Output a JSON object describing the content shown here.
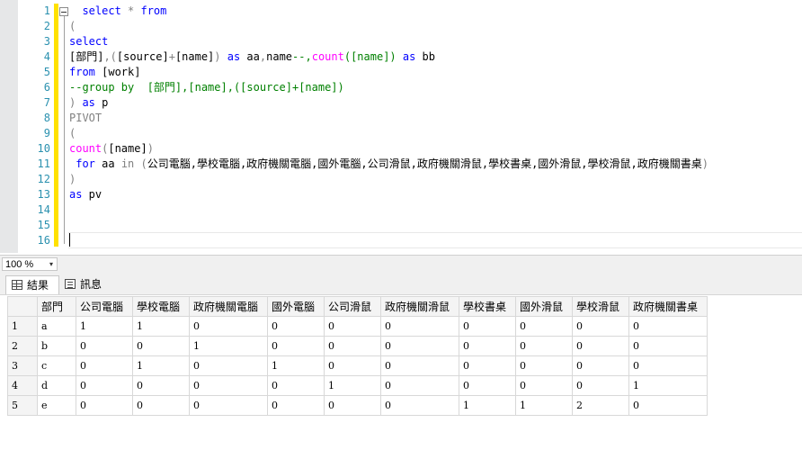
{
  "editor": {
    "line_numbers": [
      "1",
      "2",
      "3",
      "4",
      "5",
      "6",
      "7",
      "8",
      "9",
      "10",
      "11",
      "12",
      "13",
      "14",
      "15",
      "16"
    ],
    "lines": {
      "l1": {
        "a": "  select",
        "b": " * ",
        "c": "from"
      },
      "l2": {
        "a": "("
      },
      "l3": {
        "a": "select"
      },
      "l4": {
        "a": "[部門]",
        "b": ",(",
        "c": "[source]",
        "d": "+",
        "e": "[name]",
        "f": ") ",
        "g": "as",
        "h": " aa",
        "i": ",",
        "j": "name",
        "k": "--,count([name]) as bb"
      },
      "l4b": {
        "a": "count",
        "b": "([name]) ",
        "c": "as",
        "d": " bb"
      },
      "l5": {
        "a": "from",
        "b": " [work]"
      },
      "l6": {
        "a": "--group by  [部門],[name],([source]+[name])"
      },
      "l7": {
        "a": ") ",
        "b": "as",
        "c": " p"
      },
      "l8": {
        "a": "PIVOT"
      },
      "l9": {
        "a": "("
      },
      "l10": {
        "a": "count",
        "b": "(",
        "c": "[name]",
        "d": ")"
      },
      "l11": {
        "a": " for",
        "b": " aa ",
        "c": "in",
        "d": " (",
        "e": "公司電腦,學校電腦,政府機關電腦,國外電腦,公司滑鼠,政府機關滑鼠,學校書桌,國外滑鼠,學校滑鼠,政府機關書桌",
        "f": ")"
      },
      "l12": {
        "a": ")"
      },
      "l13": {
        "a": "as",
        "b": " pv"
      }
    }
  },
  "zoom": {
    "value": "100 %",
    "arrow": "▾"
  },
  "tabs": {
    "results": "結果",
    "messages": "訊息"
  },
  "grid": {
    "headers": [
      "部門",
      "公司電腦",
      "學校電腦",
      "政府機關電腦",
      "國外電腦",
      "公司滑鼠",
      "政府機關滑鼠",
      "學校書桌",
      "國外滑鼠",
      "學校滑鼠",
      "政府機關書桌"
    ],
    "rows": [
      {
        "num": "1",
        "cells": [
          "a",
          "1",
          "1",
          "0",
          "0",
          "0",
          "0",
          "0",
          "0",
          "0",
          "0"
        ]
      },
      {
        "num": "2",
        "cells": [
          "b",
          "0",
          "0",
          "1",
          "0",
          "0",
          "0",
          "0",
          "0",
          "0",
          "0"
        ]
      },
      {
        "num": "3",
        "cells": [
          "c",
          "0",
          "1",
          "0",
          "1",
          "0",
          "0",
          "0",
          "0",
          "0",
          "0"
        ]
      },
      {
        "num": "4",
        "cells": [
          "d",
          "0",
          "0",
          "0",
          "0",
          "1",
          "0",
          "0",
          "0",
          "0",
          "1"
        ]
      },
      {
        "num": "5",
        "cells": [
          "e",
          "0",
          "0",
          "0",
          "0",
          "0",
          "0",
          "1",
          "1",
          "2",
          "0"
        ]
      }
    ]
  },
  "colors": {
    "keyword": "#0000ff",
    "function": "#ff00ff",
    "comment": "#008000",
    "gray": "#808080",
    "line_number": "#2b91af",
    "change_bar": "#ffe100"
  }
}
